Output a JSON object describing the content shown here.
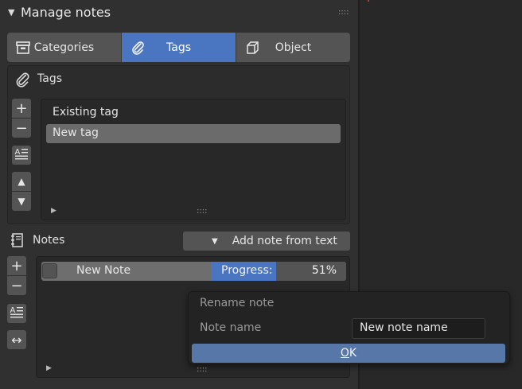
{
  "panel": {
    "title": "Manage notes",
    "collapse_icon": "triangle-down-icon",
    "grip_glyph": "::::"
  },
  "tabs": [
    {
      "label": "Categories",
      "icon": "archive-box-icon",
      "active": false
    },
    {
      "label": "Tags",
      "icon": "paperclip-icon",
      "active": true
    },
    {
      "label": "Object",
      "icon": "cube-icon",
      "active": false
    }
  ],
  "tags_section": {
    "title": "Tags",
    "icon": "paperclip-icon",
    "items": [
      {
        "label": "Existing tag",
        "selected": false
      },
      {
        "label": "New tag",
        "selected": true
      }
    ],
    "buttons": {
      "add": "+",
      "remove": "−",
      "move_up": "▲",
      "move_down": "▼"
    }
  },
  "notes_section": {
    "title": "Notes",
    "icon": "notebook-icon",
    "dropdown_label": "Add note from text",
    "dropdown_arrow": "▼",
    "note": {
      "name": "New Note",
      "checked": false,
      "progress_label": "Progress:",
      "progress_value": "51%",
      "progress_fraction": 0.51
    },
    "buttons": {
      "add": "+",
      "remove": "−",
      "resize": "↔"
    }
  },
  "popup": {
    "title": "Rename note",
    "field_label": "Note name",
    "field_value": "New note name",
    "ok_label_underlined": "O",
    "ok_label_rest": "K"
  },
  "colors": {
    "accent": "#4a75c0",
    "ok_button": "#5677a8",
    "panel_bg": "#303030",
    "list_bg": "#282828"
  }
}
